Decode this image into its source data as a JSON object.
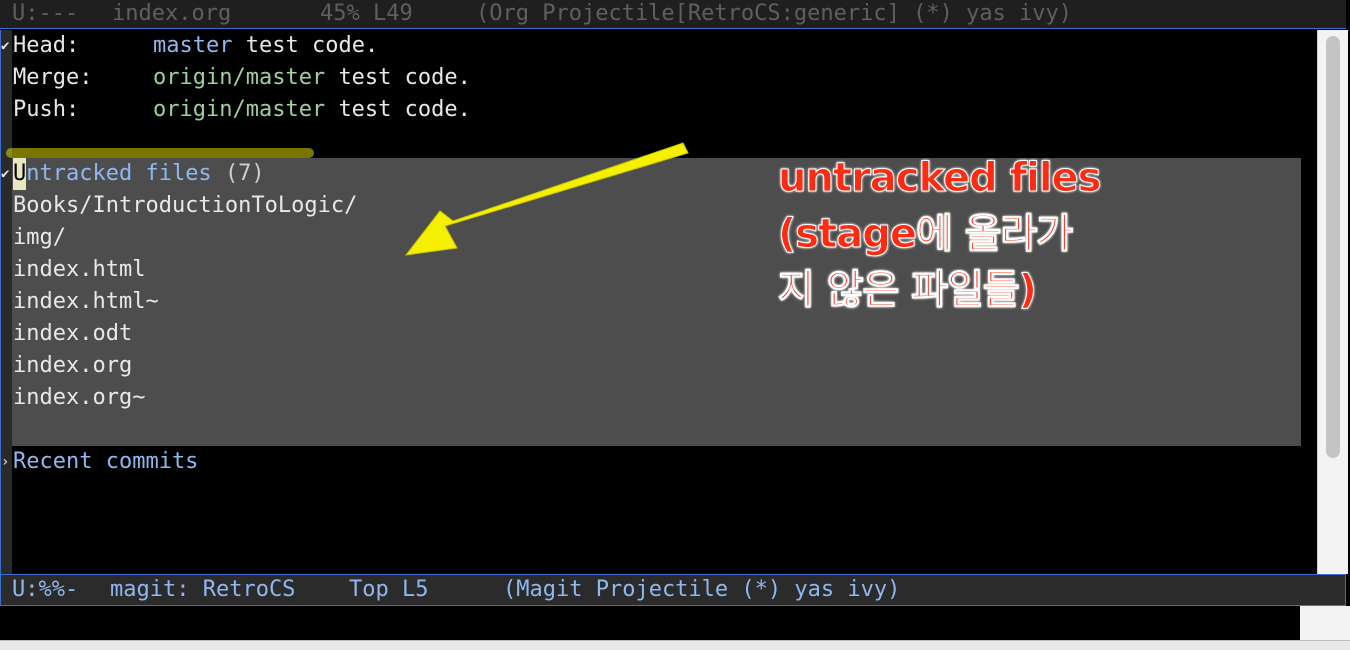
{
  "top_modeline": {
    "state": "U:---",
    "buffer": "index.org",
    "position": "45% L49",
    "modes": "(Org Projectile[RetroCS:generic] (*) yas ivy)"
  },
  "status": {
    "rows": [
      {
        "key": "Head:",
        "branch": "master",
        "message": "test code."
      },
      {
        "key": "Merge:",
        "branch": "origin/master",
        "message": "test code."
      },
      {
        "key": "Push:",
        "branch": "origin/master",
        "message": "test code."
      }
    ]
  },
  "untracked": {
    "heading": "Untracked files",
    "count": "(7)",
    "files": [
      "Books/IntroductionToLogic/",
      "img/",
      "index.html",
      "index.html~",
      "index.odt",
      "index.org",
      "index.org~"
    ]
  },
  "recent": {
    "heading": "Recent commits"
  },
  "bottom_modeline": {
    "state": "U:%%-",
    "buffer": "magit: RetroCS",
    "position": "Top L5",
    "modes": "(Magit Projectile (*) yas ivy)"
  },
  "annotation": {
    "lines": [
      "untracked files",
      "(stage에 올라가",
      "지 않은 파일들)"
    ],
    "color": "#ff2a12",
    "arrow_color": "#f5f000"
  }
}
